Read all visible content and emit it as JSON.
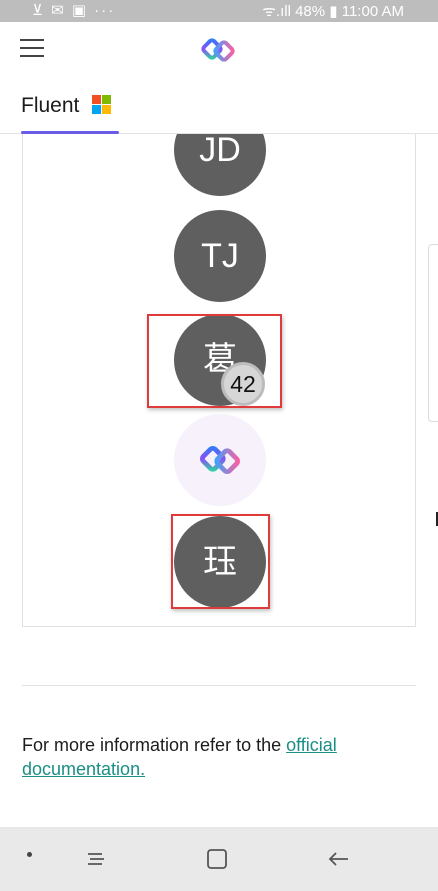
{
  "status_bar": {
    "left_icons": "⊻ ✉ ▣ ···",
    "battery": "48%",
    "time": "11:00 AM",
    "signal_text": "ᯤ.ıll"
  },
  "app_bar": {
    "menu_icon": "hamburger-menu-icon",
    "logo_icon": "fluent-logo-icon"
  },
  "tabs": [
    {
      "label": "Fluent",
      "icon": "microsoft-logo-icon",
      "selected": true
    }
  ],
  "avatars": [
    {
      "initials": "JD",
      "type": "initials"
    },
    {
      "initials": "TJ",
      "type": "initials"
    },
    {
      "initials": "葛",
      "type": "initials",
      "badge": "42",
      "highlighted": true
    },
    {
      "initials": "",
      "type": "image",
      "icon": "fluent-logo-icon"
    },
    {
      "initials": "珏",
      "type": "initials",
      "highlighted": true
    }
  ],
  "footer": {
    "text": "For more information refer to the ",
    "link": "official documentation."
  },
  "nav_bar": {
    "items": [
      "dot-icon",
      "recent-apps-icon",
      "home-icon",
      "back-icon"
    ]
  },
  "colors": {
    "accent": "#6b5ce7",
    "avatar_bg": "#5f5f5f",
    "link": "#1a8f84",
    "highlight": "#e03b3b"
  }
}
